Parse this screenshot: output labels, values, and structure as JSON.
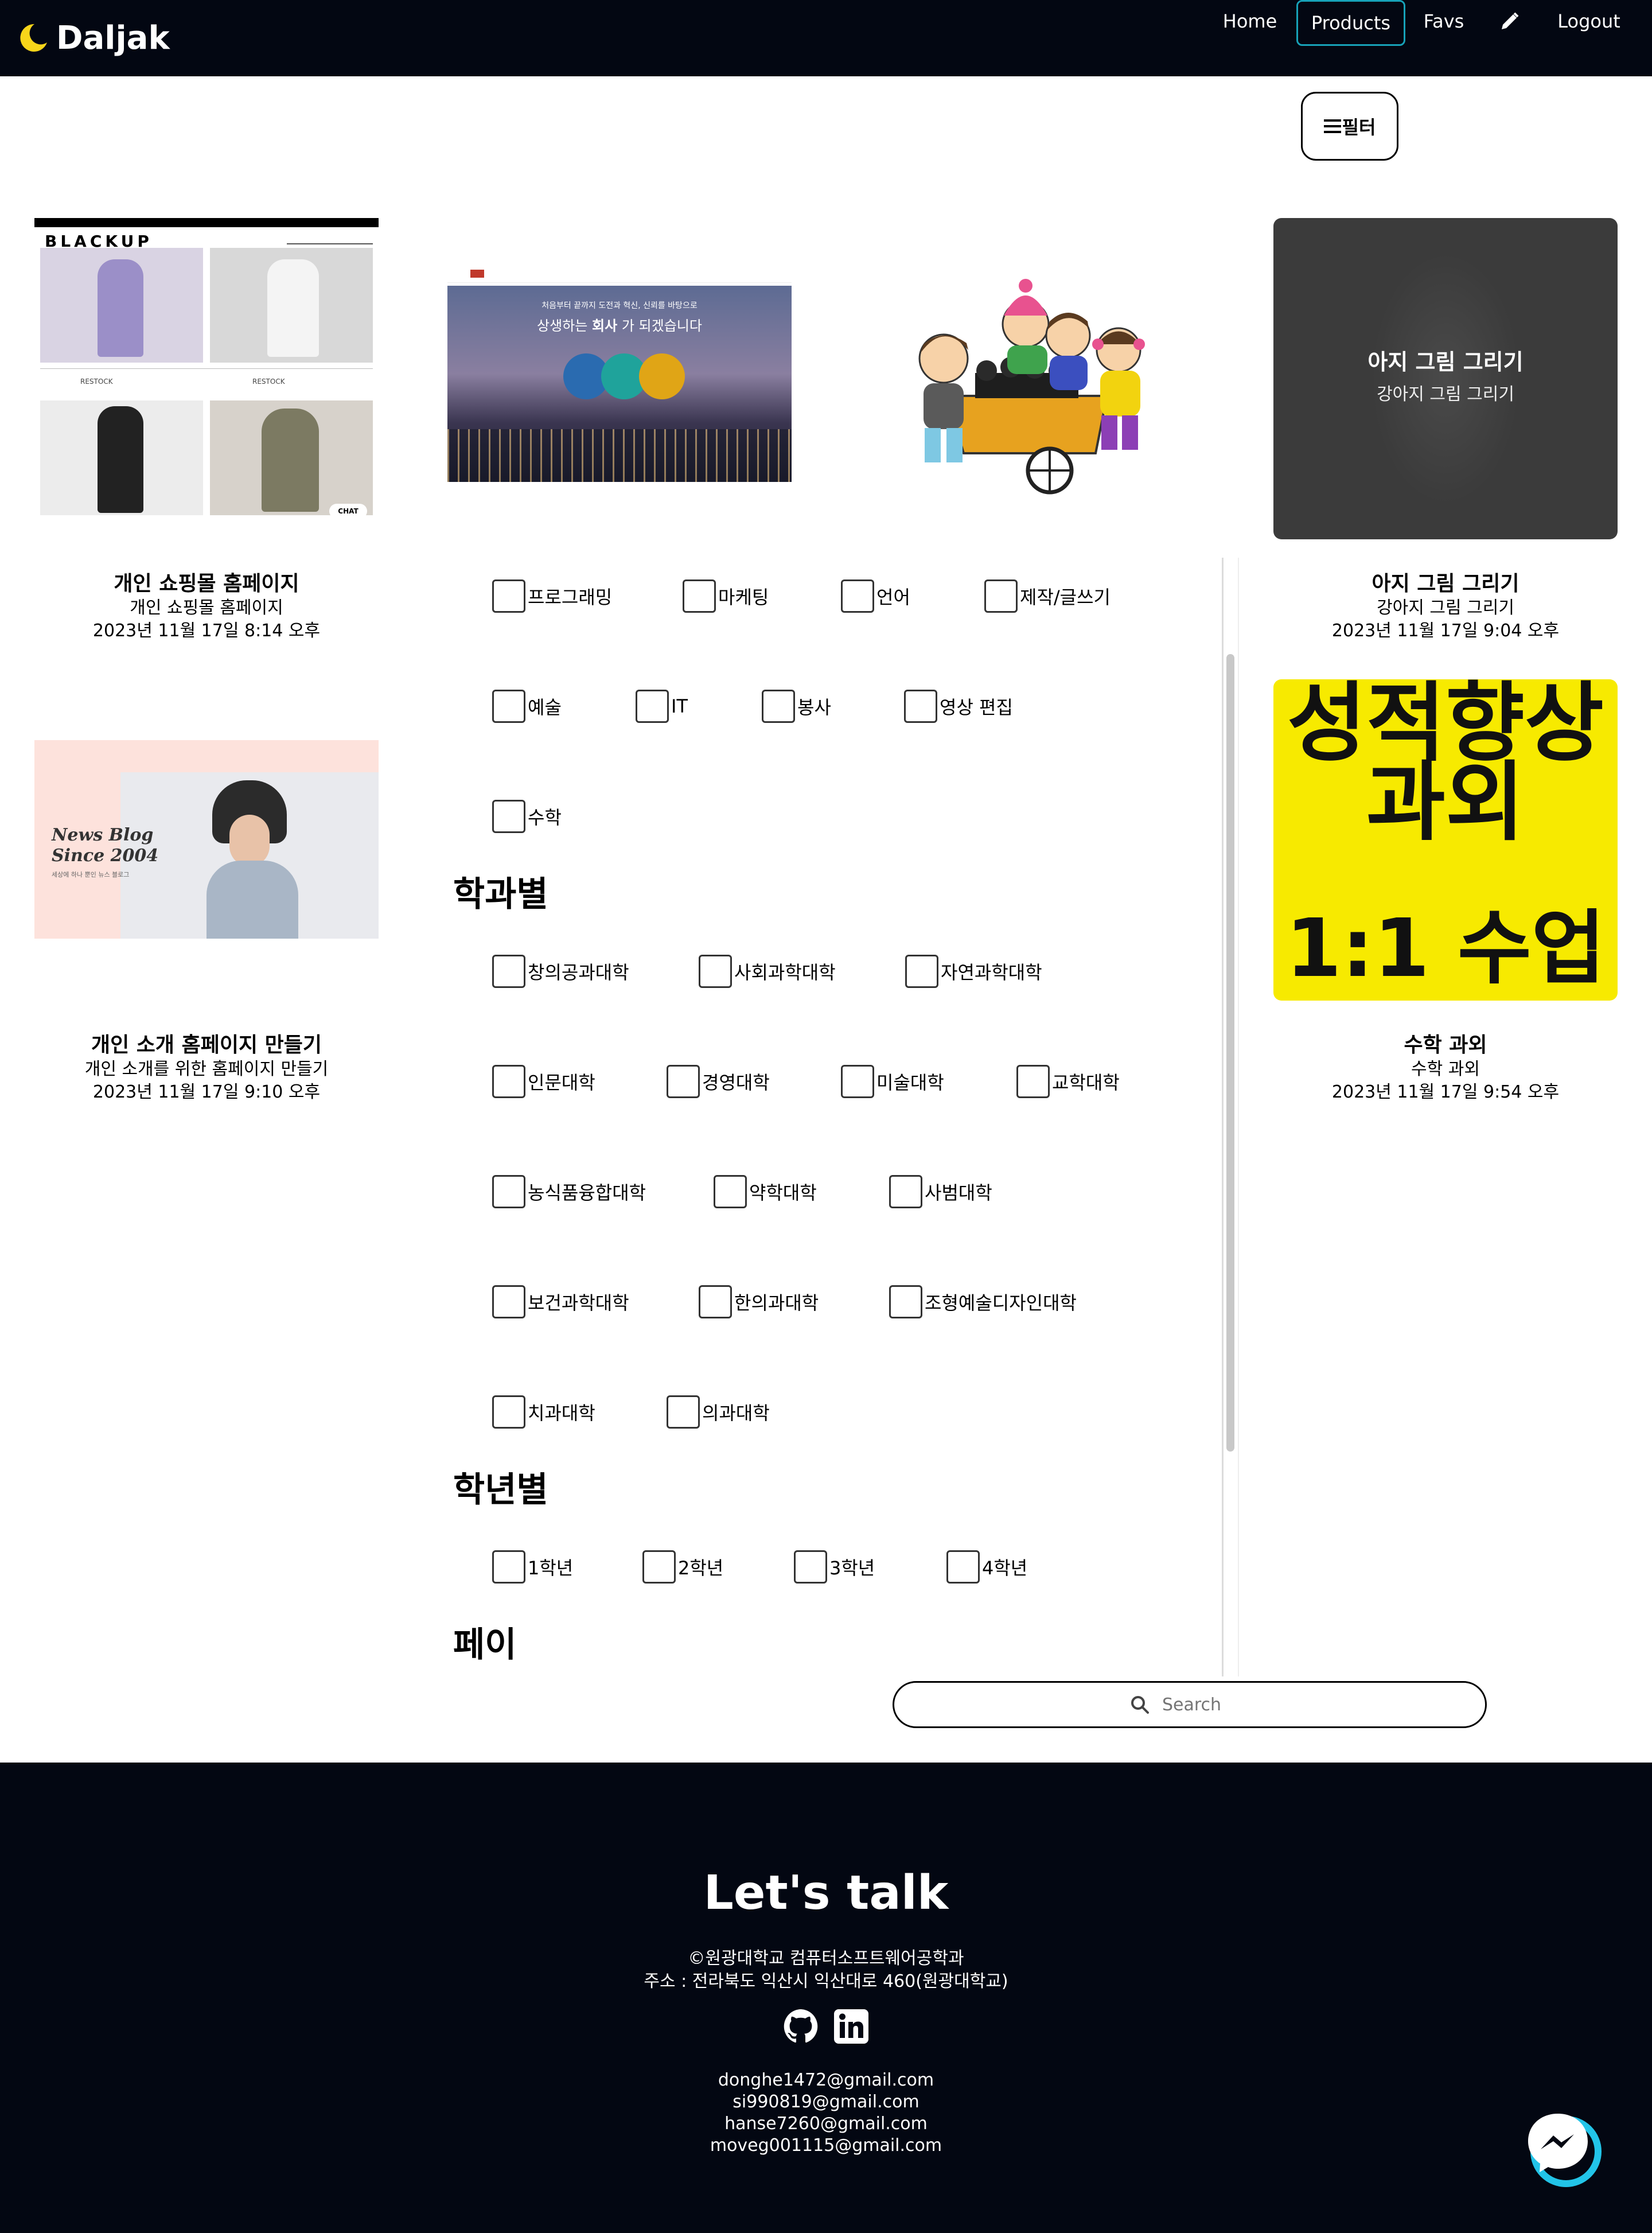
{
  "nav": {
    "brand": "Daljak",
    "items": [
      "Home",
      "Products",
      "Favs",
      "Logout"
    ],
    "active": "Products",
    "accent": "#17a2b8",
    "moon_color": "#f7d51a"
  },
  "filter_button": {
    "label": "필터",
    "icon": "hamburger-icon"
  },
  "cards": [
    {
      "title": "개인 쇼핑몰 홈페이지",
      "subtitle": "개인 쇼핑몰 홈페이지",
      "date": "2023년 11월 17일 8:14 오후",
      "thumb": {
        "brand": "BLACKUP",
        "chat": "CHAT",
        "restock": "RESTOCK"
      }
    },
    {
      "title": "",
      "subtitle": "",
      "date": "",
      "thumb": {
        "headline_pre": "상생하는",
        "headline_bold": "회사",
        "headline_post": "가 되겠습니다",
        "top_line": "처음부터 끝까지 도전과 혁신, 신뢰를 바탕으로"
      }
    },
    {
      "title": "",
      "subtitle": "",
      "date": "",
      "thumb": {
        "icon": "children-cart-illustration"
      }
    },
    {
      "title": "아지 그림 그리기",
      "subtitle": "강아지 그림 그리기",
      "date": "2023년 11월 17일 9:04 오후",
      "thumb": {
        "overlay_title": "아지 그림 그리기",
        "overlay_sub": "강아지 그림 그리기"
      }
    },
    {
      "title": "개인 소개 홈페이지 만들기",
      "subtitle": "개인 소개를 위한 홈페이지 만들기",
      "date": "2023년 11월 17일 9:10 오후",
      "thumb": {
        "line1": "News Blog",
        "line2": "Since 2004",
        "caption": "세상에 하나 뿐인 뉴스 블로그"
      }
    },
    {
      "title": "수학 과외",
      "subtitle": "수학 과외",
      "date": "2023년 11월 17일 9:54 오후",
      "thumb": {
        "line1": "성적향상",
        "line2": "과외",
        "line3": "1:1 수업",
        "bg": "#f7ea00"
      }
    }
  ],
  "filters": {
    "categories": [
      "프로그래밍",
      "마케팅",
      "언어",
      "제작/글쓰기",
      "예술",
      "IT",
      "봉사",
      "영상 편집",
      "수학"
    ],
    "department_heading": "학과별",
    "departments": [
      "창의공과대학",
      "사회과학대학",
      "자연과학대학",
      "인문대학",
      "경영대학",
      "미술대학",
      "교학대학",
      "농식품융합대학",
      "약학대학",
      "사범대학",
      "보건과학대학",
      "한의과대학",
      "조형예술디자인대학",
      "치과대학",
      "의과대학"
    ],
    "grade_heading": "학년별",
    "grades": [
      "1학년",
      "2학년",
      "3학년",
      "4학년"
    ],
    "pay_heading": "페이"
  },
  "search": {
    "placeholder": "Search",
    "icon": "search-icon"
  },
  "footer": {
    "title": "Let's talk",
    "copyright": "©원광대학교 컴퓨터소프트웨어공학과",
    "address": "주소 : 전라북도 익산시 익산대로 460(원광대학교)",
    "icons": [
      "github-icon",
      "linkedin-icon"
    ],
    "emails": [
      "donghe1472@gmail.com",
      "si990819@gmail.com",
      "hanse7260@gmail.com",
      "moveg001115@gmail.com"
    ]
  },
  "chat_fab": {
    "icon": "messenger-icon"
  }
}
